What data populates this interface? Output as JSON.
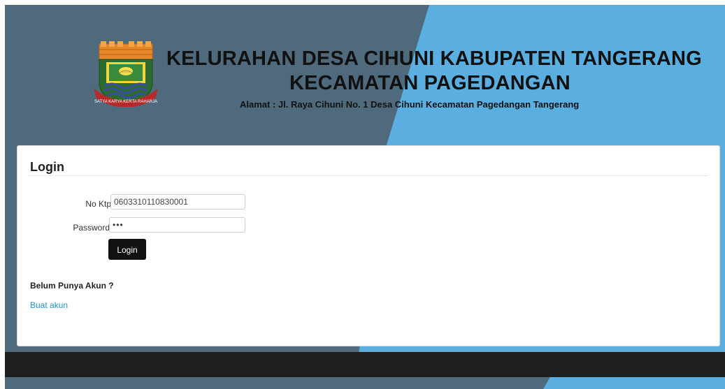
{
  "header": {
    "title_line1": "KELURAHAN DESA CIHUNI KABUPATEN TANGERANG",
    "title_line2": "KECAMATAN PAGEDANGAN",
    "address": "Alamat : Jl. Raya Cihuni No. 1 Desa Cihuni Kecamatan Pagedangan Tangerang",
    "logo_motto": "SATYA KARYA KERTA RAHARJA"
  },
  "login": {
    "title": "Login",
    "ktp_label": "No Ktp",
    "ktp_value": "0603310110830001",
    "password_label": "Password",
    "password_value": "•••",
    "button_label": "Login"
  },
  "signup": {
    "question": "Belum Punya Akun ?",
    "link_label": "Buat akun"
  },
  "colors": {
    "sky": "#5aaee0",
    "slate": "#4f6a7c",
    "footer": "#1f1f1f",
    "link": "#2a8fc8"
  }
}
